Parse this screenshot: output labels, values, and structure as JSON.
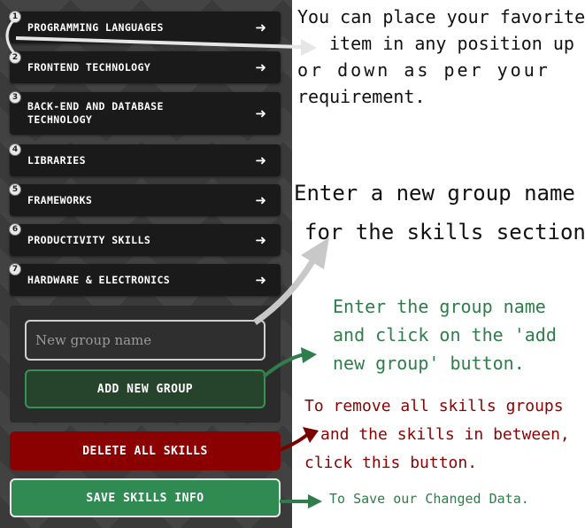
{
  "groups": [
    {
      "num": "1",
      "label": "PROGRAMMING LANGUAGES"
    },
    {
      "num": "2",
      "label": "FRONTEND TECHNOLOGY"
    },
    {
      "num": "3",
      "label": "BACK-END AND DATABASE TECHNOLOGY"
    },
    {
      "num": "4",
      "label": "LIBRARIES"
    },
    {
      "num": "5",
      "label": "FRAMEWORKS"
    },
    {
      "num": "6",
      "label": "PRODUCTIVITY SKILLS"
    },
    {
      "num": "7",
      "label": "HARDWARE & ELECTRONICS"
    }
  ],
  "arrow_glyph": "➜",
  "form": {
    "group_name_placeholder": "New group name",
    "add_group_label": "ADD NEW GROUP"
  },
  "actions": {
    "delete_all_label": "DELETE ALL SKILLS",
    "save_label": "SAVE SKILLS INFO"
  },
  "annotations": {
    "reorder_line1": "You can place your favorite",
    "reorder_line2": "item in any position up",
    "reorder_line3": "or down as per your",
    "reorder_line4": "requirement.",
    "group_name_line1": "Enter a new group name",
    "group_name_line2": "for the skills section.",
    "add_group_line1": "Enter the group name",
    "add_group_line2": "and click on the 'add",
    "add_group_line3": "new group' button.",
    "delete_line1": "To remove all skills groups",
    "delete_line2": "and the skills in between,",
    "delete_line3": "click this button.",
    "save_note": "To Save our Changed Data."
  },
  "colors": {
    "annotation_black": "#111111",
    "annotation_green": "#2e7d4a",
    "annotation_red": "#8b0000",
    "delete_button": "#8b0000",
    "save_button": "#2f8b52"
  }
}
